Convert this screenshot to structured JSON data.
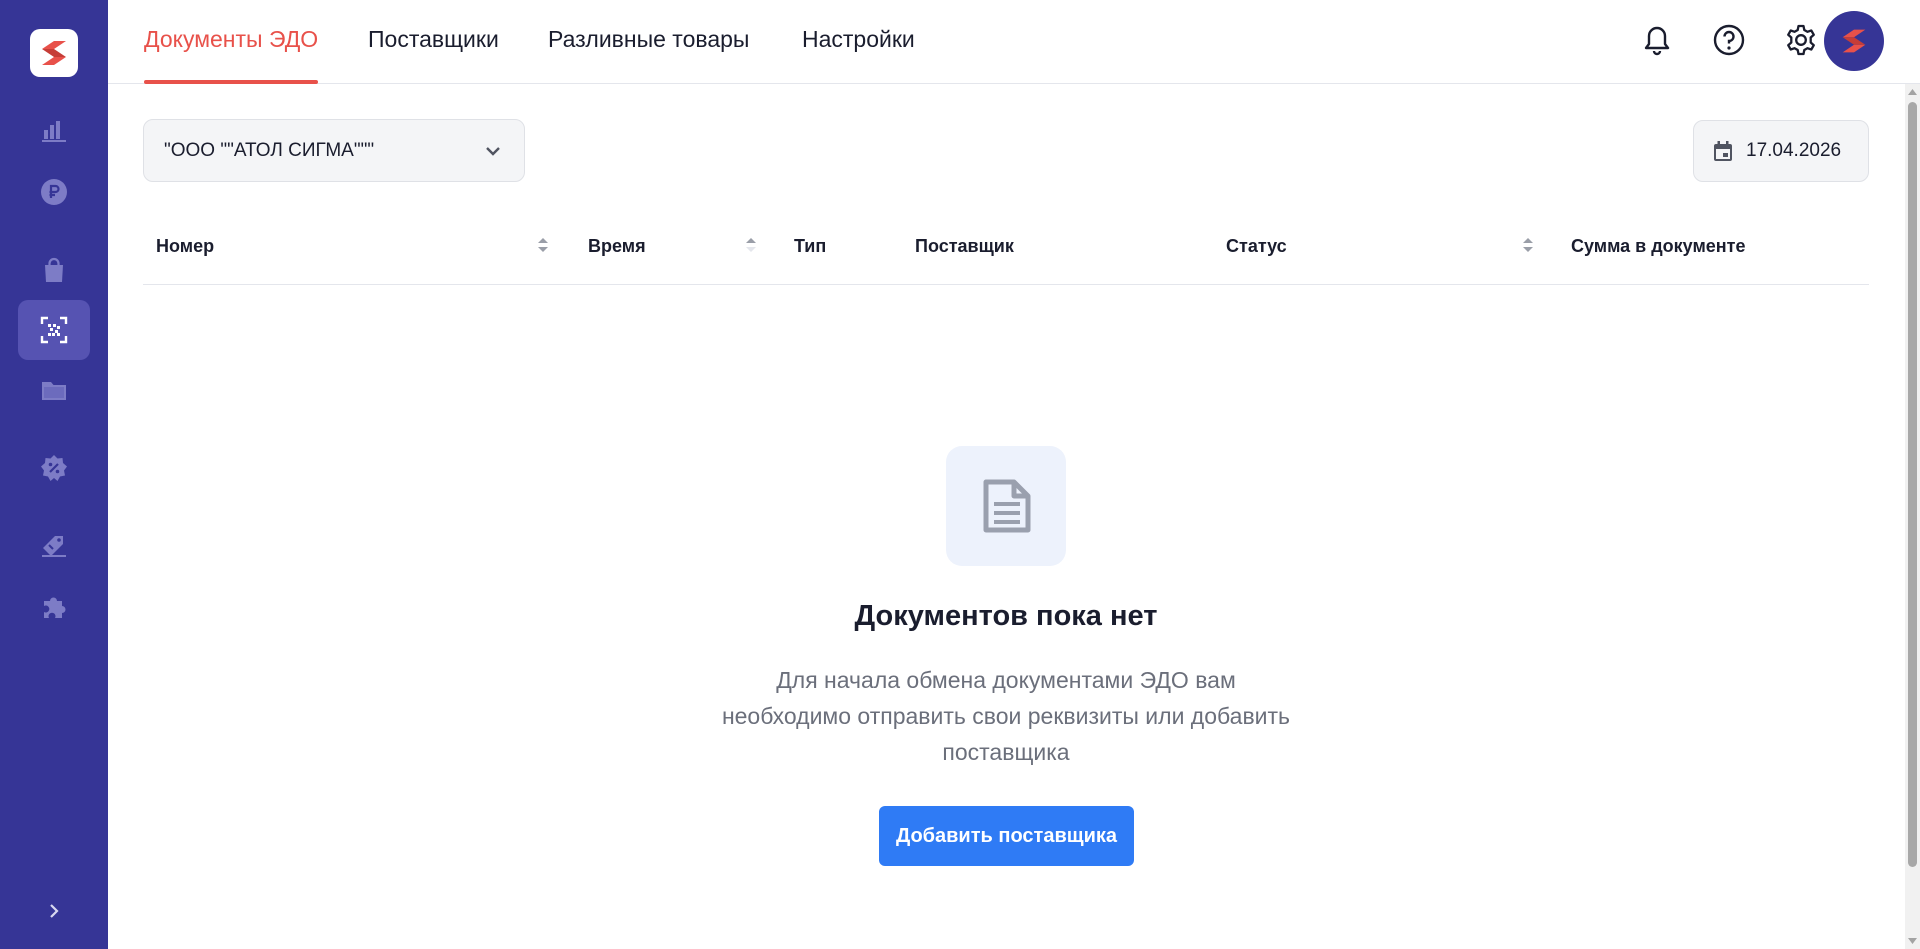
{
  "header": {
    "tabs": [
      {
        "label": "Документы ЭДО",
        "active": true
      },
      {
        "label": "Поставщики",
        "active": false
      },
      {
        "label": "Разливные товары",
        "active": false
      },
      {
        "label": "Настройки",
        "active": false
      }
    ],
    "icons": [
      "bell-icon",
      "help-icon",
      "gear-icon",
      "avatar-logo"
    ]
  },
  "sidebar": {
    "items": [
      {
        "icon": "bar-chart-icon",
        "active": false
      },
      {
        "icon": "ruble-icon",
        "active": false
      },
      {
        "icon": "shopping-bag-icon",
        "active": false
      },
      {
        "icon": "datamatrix-scan-icon",
        "active": true
      },
      {
        "icon": "folder-icon",
        "active": false
      },
      {
        "icon": "discount-badge-icon",
        "active": false
      },
      {
        "icon": "tag-edit-icon",
        "active": false
      },
      {
        "icon": "puzzle-icon",
        "active": false
      }
    ],
    "expand_icon": "chevron-right-icon"
  },
  "filters": {
    "organization": "\"ООО \"\"АТОЛ СИГМА\"\"\"",
    "date": "17.04.2026"
  },
  "table": {
    "columns": [
      {
        "label": "Номер",
        "sortable": true
      },
      {
        "label": "Время",
        "sortable": true
      },
      {
        "label": "Тип",
        "sortable": false
      },
      {
        "label": "Поставщик",
        "sortable": false
      },
      {
        "label": "Статус",
        "sortable": true
      },
      {
        "label": "Сумма в документе",
        "sortable": false
      }
    ],
    "rows": []
  },
  "empty_state": {
    "title": "Документов пока нет",
    "description": "Для начала обмена документами ЭДО вам необходимо отправить свои реквизиты или добавить поставщика",
    "button_label": "Добавить поставщика"
  },
  "colors": {
    "sidebar": "#363596",
    "accent_red": "#e8514a",
    "primary_blue": "#2f7bf5"
  }
}
